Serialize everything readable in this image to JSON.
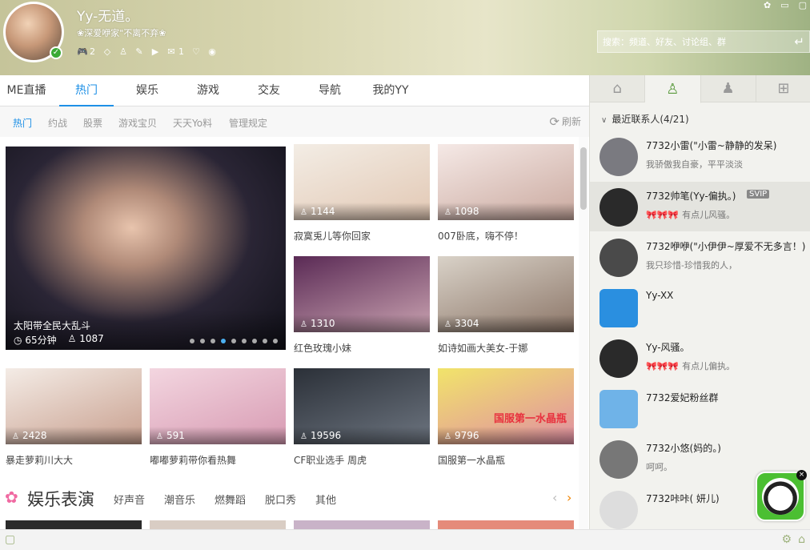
{
  "header": {
    "username": "Yy-无道。",
    "signature": "❀深爱咿家\"不离不弃❀",
    "status_counts": {
      "game": "2",
      "chat": "1"
    },
    "search_placeholder": "搜索：频道、好友、讨论组、群"
  },
  "main_tabs": [
    "ME直播",
    "热门",
    "娱乐",
    "游戏",
    "交友",
    "导航",
    "我的YY"
  ],
  "sub_tabs": [
    "热门",
    "约战",
    "股票",
    "游戏宝贝",
    "天天Yo料",
    "管理规定"
  ],
  "refresh_label": "刷新",
  "featured": {
    "caption": "太阳带全民大乱斗",
    "duration": "65分钟",
    "viewers": "1087"
  },
  "cards": [
    {
      "viewers": "1144",
      "title": "寂寞兎儿等你回家",
      "colors": [
        "#f3ede5",
        "#e2c8b4"
      ]
    },
    {
      "viewers": "1098",
      "title": "007卧底，嗨不停！",
      "colors": [
        "#f5e9e6",
        "#caa99f"
      ]
    },
    {
      "viewers": "1310",
      "title": "红色玫瑰小妹",
      "colors": [
        "#5a2a55",
        "#c9a2b0"
      ]
    },
    {
      "viewers": "3304",
      "title": "如诗如画大美女-于娜",
      "colors": [
        "#d9d2c8",
        "#8c7668"
      ]
    },
    {
      "viewers": "2428",
      "title": "暴走萝莉川大大",
      "colors": [
        "#f4ece6",
        "#c89f8e"
      ]
    },
    {
      "viewers": "591",
      "title": "嘟嘟萝莉带你看热舞",
      "colors": [
        "#f3d6e0",
        "#d79ab2"
      ]
    },
    {
      "viewers": "19596",
      "title": "CF职业选手 周虎",
      "colors": [
        "#2b3038",
        "#6d7580"
      ]
    },
    {
      "viewers": "9796",
      "title": "国服第一水晶瓶",
      "colors": [
        "#f1e46a",
        "#e08ea3"
      ]
    }
  ],
  "card9_overlay": "国服第一水晶瓶",
  "section": {
    "title": "娱乐表演",
    "tabs": [
      "好声音",
      "潮音乐",
      "燃舞蹈",
      "脱口秀",
      "其他"
    ]
  },
  "right_panel": {
    "group_label": "最近联系人(4/21)",
    "contacts": [
      {
        "name": "7732小雷(\"小雷~静静的发呆)",
        "msg": "我骄傲我自豪，平平淡淡",
        "emotes": "",
        "avatar_color": "#7a7a80"
      },
      {
        "name": "7732帅笔(Yy-偏执。)",
        "badge": "SVIP",
        "msg": "有点儿风骚。",
        "emotes": "🎀🎀🎀",
        "avatar_color": "#2a2a2a"
      },
      {
        "name": "7732咿咿(\"小伊伊~厚爱不无多言！)",
        "msg": "我只珍惜-珍惜我的人，",
        "emotes": "",
        "avatar_color": "#4a4a4a"
      },
      {
        "name": "Yy-XX",
        "msg": "",
        "emotes": "",
        "avatar_color": "#2a8fe0"
      },
      {
        "name": "Yy-风骚。",
        "msg": "有点儿偏执。",
        "emotes": "🎀🎀🎀",
        "avatar_color": "#2a2a2a"
      },
      {
        "name": "7732爱妃粉丝群",
        "msg": "",
        "emotes": "",
        "avatar_color": "#6fb3e8"
      },
      {
        "name": "7732小悠(妈的。)",
        "msg": "呵呵。",
        "emotes": "",
        "avatar_color": "#777"
      },
      {
        "name": "7732咔咔(    妍儿)",
        "msg": "",
        "emotes": "",
        "avatar_color": "#ddd"
      }
    ]
  }
}
